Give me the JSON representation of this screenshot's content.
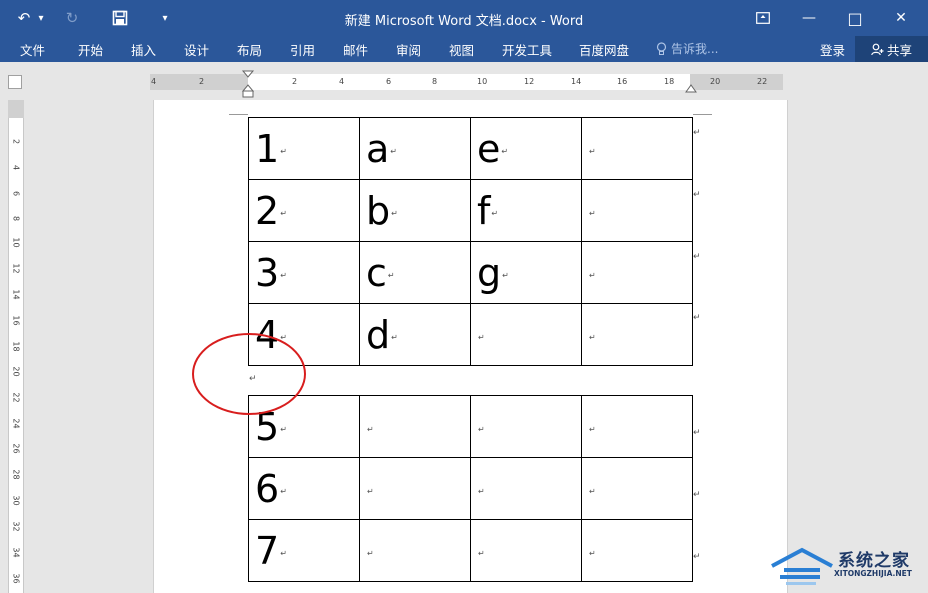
{
  "window": {
    "title": "新建 Microsoft Word 文档.docx - Word",
    "minimize_glyph": "—",
    "maximize_glyph": "□",
    "close_glyph": "✕",
    "ribbon_display_icon": "ribbon-display-options-icon"
  },
  "quick_access": {
    "undo_glyph": "↶",
    "dropdown_glyph": "▾",
    "redo_glyph": "↻",
    "save_icon": "save-icon",
    "customize_glyph": "▾"
  },
  "ribbon": {
    "tabs": [
      "文件",
      "开始",
      "插入",
      "设计",
      "布局",
      "引用",
      "邮件",
      "审阅",
      "视图",
      "开发工具",
      "百度网盘"
    ],
    "tell_me": "告诉我...",
    "sign_in": "登录",
    "share": "共享"
  },
  "ruler": {
    "horizontal": [
      "4",
      "2",
      "2",
      "4",
      "6",
      "8",
      "10",
      "12",
      "14",
      "16",
      "18",
      "20",
      "22"
    ],
    "vertical": [
      "2",
      "4",
      "6",
      "8",
      "10",
      "12",
      "14",
      "16",
      "18",
      "20",
      "22",
      "24",
      "26",
      "28",
      "30",
      "32",
      "34",
      "36"
    ]
  },
  "document": {
    "paragraph_mark": "↵",
    "table1": [
      [
        "1",
        "a",
        "e",
        ""
      ],
      [
        "2",
        "b",
        "f",
        ""
      ],
      [
        "3",
        "c",
        "g",
        ""
      ],
      [
        "4",
        "d",
        "",
        ""
      ]
    ],
    "table2": [
      [
        "5",
        "",
        "",
        ""
      ],
      [
        "6",
        "",
        "",
        ""
      ],
      [
        "7",
        "",
        "",
        ""
      ]
    ]
  },
  "annotation": {
    "color": "#d81e1e"
  },
  "watermark": {
    "name": "系统之家",
    "url": "XITONGZHIJIA.NET"
  },
  "colors": {
    "accent": "#2b579a",
    "share_bg": "#1e4378"
  }
}
